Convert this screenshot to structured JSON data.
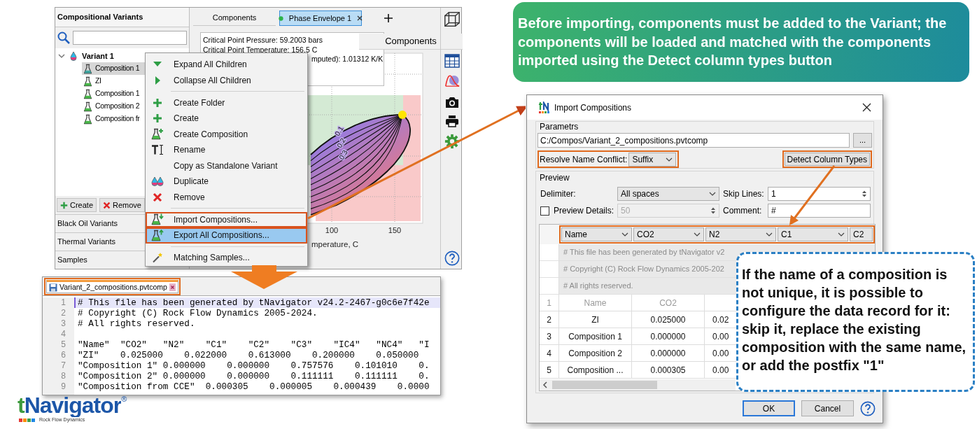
{
  "app": {
    "variants_panel": {
      "title": "Compositional Variants",
      "tree": [
        {
          "label": "Variant 1",
          "expanded": true,
          "children": [
            {
              "label": "Composition 1",
              "selected": true
            },
            {
              "label": "ZI",
              "selected": false
            },
            {
              "label": "Composition 1",
              "selected": false
            },
            {
              "label": "Composition 2",
              "selected": false
            },
            {
              "label": "Composition fr",
              "selected": false
            }
          ]
        }
      ],
      "buttons": [
        {
          "label": "Create",
          "kind": "create"
        },
        {
          "label": "Remove",
          "kind": "remove"
        }
      ],
      "sections": [
        "Black Oil Variants",
        "Thermal Variants",
        "Samples"
      ]
    },
    "tabs": [
      {
        "label": "Components",
        "selected": false
      },
      {
        "label": "Phase Envelope 1",
        "selected": true
      }
    ],
    "info_lines": [
      "Critical Point Pressure: 59.2003 bars",
      "Critical Point Temperature: 156.5 C",
      "mputed): 1.01312 K/K"
    ],
    "components_header": "Components",
    "plot": {
      "contour_labels": [
        "0.1",
        "0.2",
        "0.3"
      ],
      "x_tick_labels": [
        "100",
        "150"
      ],
      "x_axis_label": "mperature, C"
    },
    "toolbar": [
      {
        "kind": "cube"
      },
      {
        "kind": "table"
      },
      {
        "kind": "envelope"
      },
      {
        "kind": "camera"
      },
      {
        "kind": "printer"
      },
      {
        "kind": "gear"
      },
      {
        "kind": "help"
      }
    ]
  },
  "context_menu": {
    "items": [
      {
        "kind": "item",
        "label": "Expand All Children",
        "selected": false,
        "outlined": false
      },
      {
        "kind": "item",
        "label": "Collapse All Children",
        "selected": false,
        "outlined": false
      },
      {
        "kind": "separator"
      },
      {
        "kind": "item",
        "label": "Create Folder",
        "selected": false,
        "outlined": false
      },
      {
        "kind": "item",
        "label": "Create",
        "selected": false,
        "outlined": false
      },
      {
        "kind": "item",
        "label": "Create Composition",
        "selected": false,
        "outlined": false
      },
      {
        "kind": "item",
        "label": "Rename",
        "selected": false,
        "outlined": false
      },
      {
        "kind": "item",
        "label": "Copy as Standalone Variant",
        "selected": false,
        "outlined": false
      },
      {
        "kind": "item",
        "label": "Duplicate",
        "selected": false,
        "outlined": false
      },
      {
        "kind": "item",
        "label": "Remove",
        "selected": false,
        "outlined": false
      },
      {
        "kind": "separator"
      },
      {
        "kind": "item",
        "label": "Import Compositions...",
        "selected": false,
        "outlined": true
      },
      {
        "kind": "item",
        "label": "Export All Compositions...",
        "selected": true,
        "outlined": true
      },
      {
        "kind": "separator"
      },
      {
        "kind": "item",
        "label": "Matching Samples...",
        "selected": false,
        "outlined": false
      }
    ]
  },
  "editor": {
    "tab": "Variant_2_compositions.pvtcomp",
    "lines": [
      {
        "number": "1",
        "text": "# This file has been generated by tNavigator v24.2-2467-g0c6e7f42e",
        "current": true
      },
      {
        "number": "2",
        "text": "# Copyright (C) Rock Flow Dynamics 2005-2024.",
        "current": false
      },
      {
        "number": "3",
        "text": "# All rights reserved.",
        "current": false
      },
      {
        "number": "4",
        "current": false
      },
      {
        "number": "5",
        "text": "\"Name\"  \"CO2\"   \"N2\"    \"C1\"    \"C2\"    \"C3\"    \"IC4\"   \"NC4\"   \"I",
        "current": false
      },
      {
        "number": "6",
        "text": "\"ZI\"    0.025000    0.022000    0.613000    0.200000    0.050000",
        "current": false
      },
      {
        "number": "7",
        "text": "\"Composition 1\" 0.000000    0.000000    0.757576    0.101010    0.",
        "current": false
      },
      {
        "number": "8",
        "text": "\"Composition 2\" 0.000000    0.000000    0.111111    0.111111    0.",
        "current": false
      },
      {
        "number": "9",
        "text": "\"Composition from CCE\"  0.000305    0.000005    0.000439    0.0000",
        "current": false
      }
    ]
  },
  "dialog": {
    "title": "Import Compositions",
    "parameters_label": "Parametrs",
    "file_path": "C:/Compos/Variant_2_compositions.pvtcomp",
    "browse_button": "...",
    "resolve_label": "Resolve Name Conflict:",
    "resolve_select": "Suffix",
    "detect_button": "Detect Column Types",
    "preview_label": "Preview",
    "delimiter_label": "Delimiter:",
    "delimiter_select": "All spaces",
    "skip_lines_label": "Skip Lines:",
    "skip_lines_value": "1",
    "preview_details": {
      "label": "Preview Details:",
      "checked": false
    },
    "preview_count": {
      "value": "50",
      "disabled": true
    },
    "comment_label": "Comment:",
    "comment_value": "#",
    "column_types": [
      "Name",
      "CO2",
      "N2",
      "C1",
      "C2"
    ],
    "comment_rows": [
      "# This file has been generated by tNavigator v2",
      "# Copyright (C) Rock Flow Dynamics 2005-202",
      "# All rights reserved."
    ],
    "rows": [
      {
        "number": "1",
        "skipped": true,
        "cells": [
          "Name",
          "CO2"
        ]
      },
      {
        "number": "2",
        "skipped": false,
        "cells": [
          "ZI",
          "0.025000",
          "0.02"
        ]
      },
      {
        "number": "3",
        "skipped": false,
        "cells": [
          "Composition 1",
          "0.000000",
          "0.00"
        ]
      },
      {
        "number": "4",
        "skipped": false,
        "cells": [
          "Composition 2",
          "0.000000",
          "0.00"
        ]
      },
      {
        "number": "5",
        "skipped": false,
        "cells": [
          "Composition ...",
          "0.000305",
          "0.00"
        ]
      }
    ],
    "buttons": [
      {
        "label": "OK",
        "default": true
      },
      {
        "label": "Cancel",
        "default": false
      }
    ]
  },
  "callouts": [
    {
      "kind": "banner",
      "text": "Before importing, components must be added to the Variant; the components will be loaded and matched with the components imported using the Detect column types button"
    },
    {
      "kind": "note",
      "text": "If the name of a composition is not unique, it is possible to configure the data record for it: skip it, replace the existing composition with the same name, or add the postfix \"1\""
    }
  ],
  "logo": {
    "name": "tNavigator",
    "mark": "®",
    "tagline": "Rock Flow Dynamics"
  }
}
